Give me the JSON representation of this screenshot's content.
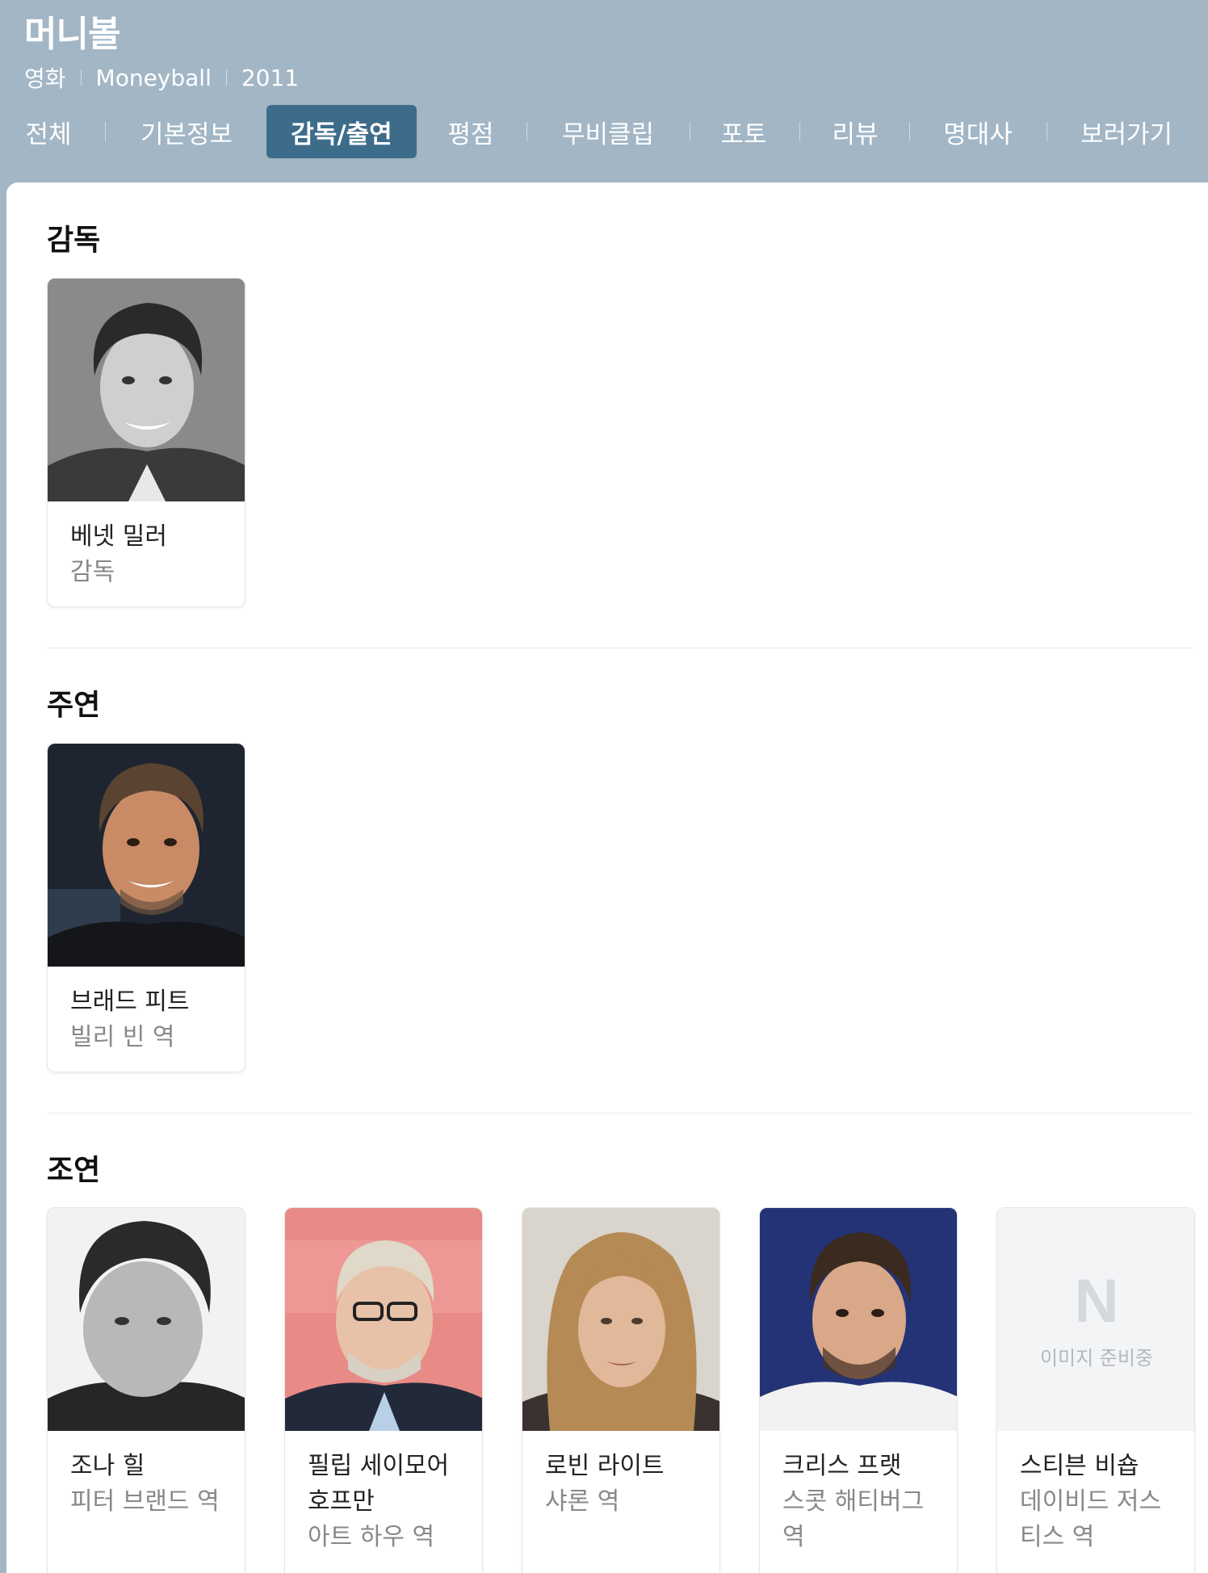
{
  "header": {
    "title": "머니볼",
    "meta": [
      "영화",
      "Moneyball",
      "2011"
    ]
  },
  "tabs": [
    {
      "label": "전체",
      "active": false
    },
    {
      "label": "기본정보",
      "active": false
    },
    {
      "label": "감독/출연",
      "active": true
    },
    {
      "label": "평점",
      "active": false
    },
    {
      "label": "무비클립",
      "active": false
    },
    {
      "label": "포토",
      "active": false
    },
    {
      "label": "리뷰",
      "active": false
    },
    {
      "label": "명대사",
      "active": false
    },
    {
      "label": "보러가기",
      "active": false
    }
  ],
  "sections": {
    "director": {
      "title": "감독",
      "people": [
        {
          "name": "베넷 밀러",
          "role": "감독"
        }
      ]
    },
    "lead": {
      "title": "주연",
      "people": [
        {
          "name": "브래드 피트",
          "role": "빌리 빈 역"
        }
      ]
    },
    "supporting": {
      "title": "조연",
      "people": [
        {
          "name": "조나 힐",
          "role": "피터 브랜드 역"
        },
        {
          "name": "필립 세이모어 호프만",
          "role": "아트 하우 역"
        },
        {
          "name": "로빈 라이트",
          "role": "샤론 역"
        },
        {
          "name": "크리스 프랫",
          "role": "스콧 해티버그 역"
        },
        {
          "name": "스티븐 비숍",
          "role": "데이비드 저스티스 역",
          "placeholder_text": "이미지 준비중",
          "placeholder_logo": "N"
        }
      ]
    }
  },
  "colors": {
    "header_bg": "#a2b6c5",
    "active_tab_bg": "#3d6c8a"
  }
}
